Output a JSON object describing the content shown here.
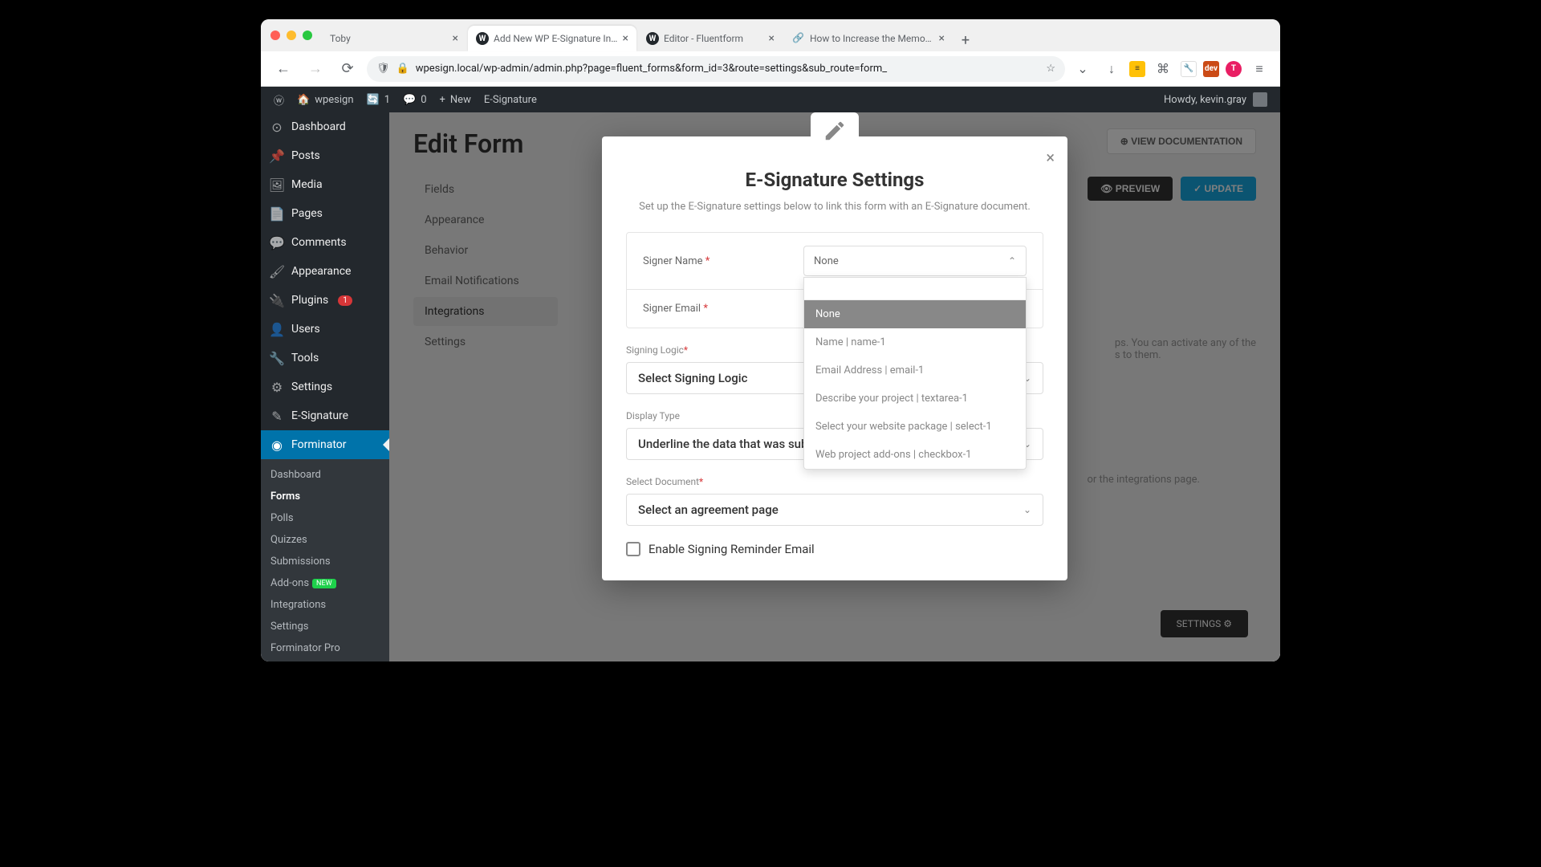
{
  "browser": {
    "tabs": [
      {
        "title": "Toby",
        "active": false,
        "favicon": "toby"
      },
      {
        "title": "Add New WP E-Signature Integr",
        "active": true,
        "favicon": "wp"
      },
      {
        "title": "Editor - Fluentform",
        "active": false,
        "favicon": "wp"
      },
      {
        "title": "How to Increase the Memory Li",
        "active": false,
        "favicon": "link"
      }
    ],
    "url": "wpesign.local/wp-admin/admin.php?page=fluent_forms&form_id=3&route=settings&sub_route=form_"
  },
  "adminbar": {
    "site": "wpesign",
    "updates": "1",
    "comments": "0",
    "new": "New",
    "esig": "E-Signature",
    "howdy": "Howdy, kevin.gray"
  },
  "sidebar": {
    "items": [
      {
        "label": "Dashboard",
        "icon": "dashboard"
      },
      {
        "label": "Posts",
        "icon": "pin"
      },
      {
        "label": "Media",
        "icon": "media"
      },
      {
        "label": "Pages",
        "icon": "page"
      },
      {
        "label": "Comments",
        "icon": "comment"
      },
      {
        "label": "Appearance",
        "icon": "brush"
      },
      {
        "label": "Plugins",
        "icon": "plugin",
        "badge": "1"
      },
      {
        "label": "Users",
        "icon": "user"
      },
      {
        "label": "Tools",
        "icon": "wrench"
      },
      {
        "label": "Settings",
        "icon": "sliders"
      },
      {
        "label": "E-Signature",
        "icon": "pen"
      },
      {
        "label": "Forminator",
        "icon": "forminator",
        "current": true
      }
    ],
    "submenu": [
      {
        "label": "Dashboard"
      },
      {
        "label": "Forms",
        "current": true
      },
      {
        "label": "Polls"
      },
      {
        "label": "Quizzes"
      },
      {
        "label": "Submissions"
      },
      {
        "label": "Add-ons",
        "badge_new": "NEW"
      },
      {
        "label": "Integrations"
      },
      {
        "label": "Settings"
      },
      {
        "label": "Forminator Pro"
      }
    ]
  },
  "page": {
    "title": "Edit Form",
    "doc_btn": "⊕ VIEW DOCUMENTATION",
    "preview_btn": "👁 PREVIEW",
    "update_btn": "✓ UPDATE",
    "tabs": [
      "Fields",
      "Appearance",
      "Behavior",
      "Email Notifications",
      "Integrations",
      "Settings"
    ],
    "active_tab": "Integrations",
    "bg_text1": "ps. You can activate any of the",
    "bg_text2": "s to them.",
    "bg_text3": "or the integrations page.",
    "bg_settings": "SETTINGS ⚙"
  },
  "modal": {
    "title": "E-Signature Settings",
    "subtitle": "Set up the E-Signature settings below to link this form with an E-Signature document.",
    "fields": {
      "signer_name": {
        "label": "Signer Name",
        "value": "None"
      },
      "signer_email": {
        "label": "Signer Email"
      },
      "signing_logic": {
        "label": "Signing Logic",
        "placeholder": "Select Signing Logic"
      },
      "display_type": {
        "label": "Display Type",
        "value": "Underline the data that was submitted in the form"
      },
      "select_document": {
        "label": "Select Document",
        "placeholder": "Select an agreement page"
      },
      "reminder": {
        "label": "Enable Signing Reminder Email"
      }
    },
    "dropdown_options": [
      "None",
      "Name | name-1",
      "Email Address | email-1",
      "Describe your project | textarea-1",
      "Select your website package | select-1",
      "Web project add-ons | checkbox-1"
    ]
  }
}
